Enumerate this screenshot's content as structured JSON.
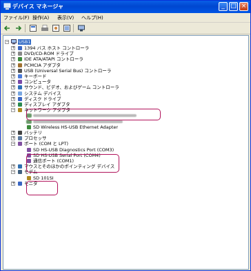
{
  "window": {
    "title": "デバイス マネージャ"
  },
  "menu": [
    {
      "label": "ファイル(F)"
    },
    {
      "label": "操作(A)"
    },
    {
      "label": "表示(V)"
    },
    {
      "label": "ヘルプ(H)"
    }
  ],
  "toolbar": {
    "buttons": [
      "back-icon",
      "forward-icon",
      "properties-icon",
      "print-icon",
      "help-icon",
      "view-icon",
      "scan-icon"
    ]
  },
  "tree": {
    "root": "USB1",
    "nodes": [
      {
        "label": "1394 バス ホスト コントローラ",
        "icon": "bus-icon"
      },
      {
        "label": "DVD/CD-ROM ドライブ",
        "icon": "cdrom-icon"
      },
      {
        "label": "IDE ATA/ATAPI コントローラ",
        "icon": "ide-icon"
      },
      {
        "label": "PCMCIA アダプタ",
        "icon": "pcmcia-icon"
      },
      {
        "label": "USB (Universal Serial Bus) コントローラ",
        "icon": "usb-icon"
      },
      {
        "label": "キーボード",
        "icon": "keyboard-icon"
      },
      {
        "label": "コンピュータ",
        "icon": "computer-icon"
      },
      {
        "label": "サウンド、ビデオ、およびゲーム コントローラ",
        "icon": "sound-icon"
      },
      {
        "label": "システム デバイス",
        "icon": "system-icon"
      },
      {
        "label": "ディスク ドライブ",
        "icon": "disk-icon"
      },
      {
        "label": "ディスプレイ アダプタ",
        "icon": "display-icon"
      },
      {
        "label": "ネットワーク アダプタ",
        "icon": "network-icon"
      }
    ],
    "network_children": [
      {
        "label": "SD Wireless HS-USB Ethernet Adapter"
      }
    ],
    "after_network": [
      {
        "label": "バッテリ",
        "icon": "battery-icon"
      },
      {
        "label": "プロセッサ",
        "icon": "processor-icon"
      },
      {
        "label": "ポート (COM と LPT)",
        "icon": "port-icon"
      }
    ],
    "port_children": [
      {
        "label": "SD HS-USB Diagnostics Port (COM3)"
      },
      {
        "label": "SD HS-USB Serial Port (COM4)"
      },
      {
        "label": "通信ポート (COM1)"
      }
    ],
    "after_ports": [
      {
        "label": "マウスとそのほかのポインティング デバイス",
        "icon": "mouse-icon"
      },
      {
        "label": "モデム",
        "icon": "modem-icon"
      }
    ],
    "modem_children": [
      {
        "label": "SD 101SI"
      }
    ],
    "last": [
      {
        "label": "モニタ",
        "icon": "monitor-icon"
      }
    ]
  },
  "colors": {
    "highlight": "#b0115a",
    "title_bar": "#0047d0"
  }
}
